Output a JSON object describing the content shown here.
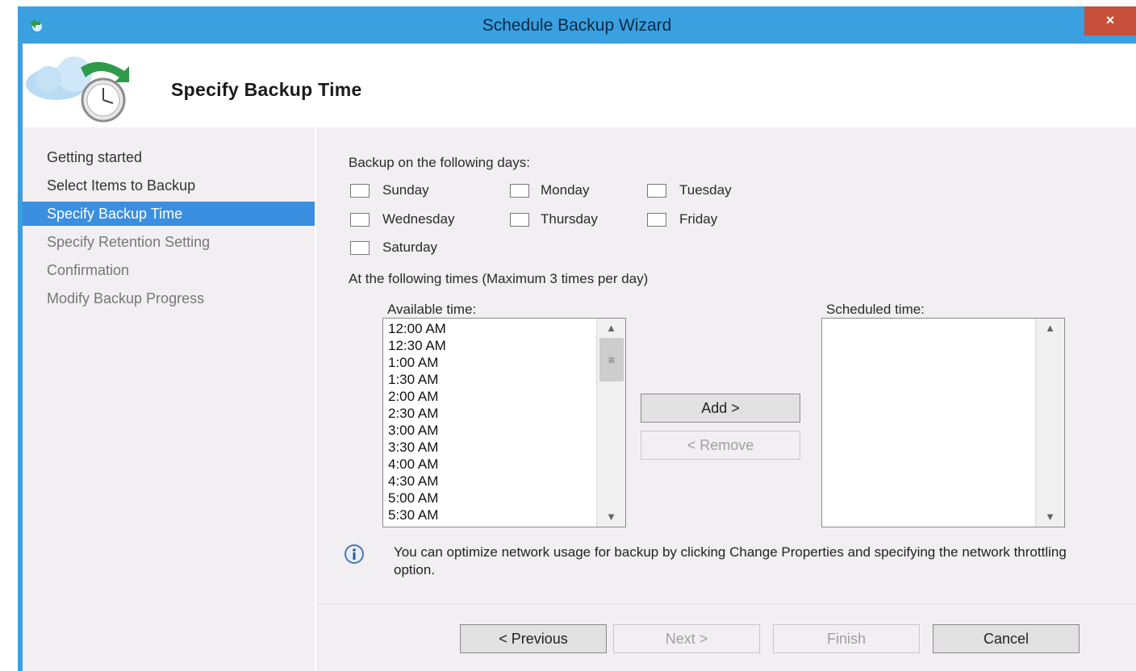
{
  "window": {
    "title": "Schedule Backup Wizard",
    "close_label": "×"
  },
  "header": {
    "title": "Specify Backup Time"
  },
  "nav": {
    "items": [
      {
        "label": "Getting started",
        "state": "done"
      },
      {
        "label": "Select Items to Backup",
        "state": "done"
      },
      {
        "label": "Specify Backup Time",
        "state": "active"
      },
      {
        "label": "Specify Retention Setting",
        "state": "pending"
      },
      {
        "label": "Confirmation",
        "state": "pending"
      },
      {
        "label": "Modify Backup Progress",
        "state": "pending"
      }
    ]
  },
  "days": {
    "label": "Backup on the following days:",
    "options": [
      {
        "label": "Sunday",
        "checked": false
      },
      {
        "label": "Monday",
        "checked": false
      },
      {
        "label": "Tuesday",
        "checked": false
      },
      {
        "label": "Wednesday",
        "checked": false
      },
      {
        "label": "Thursday",
        "checked": false
      },
      {
        "label": "Friday",
        "checked": false
      },
      {
        "label": "Saturday",
        "checked": false
      }
    ]
  },
  "times": {
    "label": "At the following times (Maximum 3 times per day)",
    "available_label": "Available time:",
    "scheduled_label": "Scheduled time:",
    "available": [
      "12:00 AM",
      "12:30 AM",
      "1:00 AM",
      "1:30 AM",
      "2:00 AM",
      "2:30 AM",
      "3:00 AM",
      "3:30 AM",
      "4:00 AM",
      "4:30 AM",
      "5:00 AM",
      "5:30 AM"
    ],
    "scheduled": [],
    "add_label": "Add >",
    "remove_label": "< Remove"
  },
  "info": {
    "text": "You can optimize network usage for backup by clicking Change Properties and specifying the network throttling option."
  },
  "footer": {
    "previous_label": "< Previous",
    "next_label": "Next >",
    "finish_label": "Finish",
    "cancel_label": "Cancel"
  },
  "colors": {
    "titlebar": "#3aa0e0",
    "active_nav": "#3a8fe0",
    "close": "#c8503a"
  }
}
